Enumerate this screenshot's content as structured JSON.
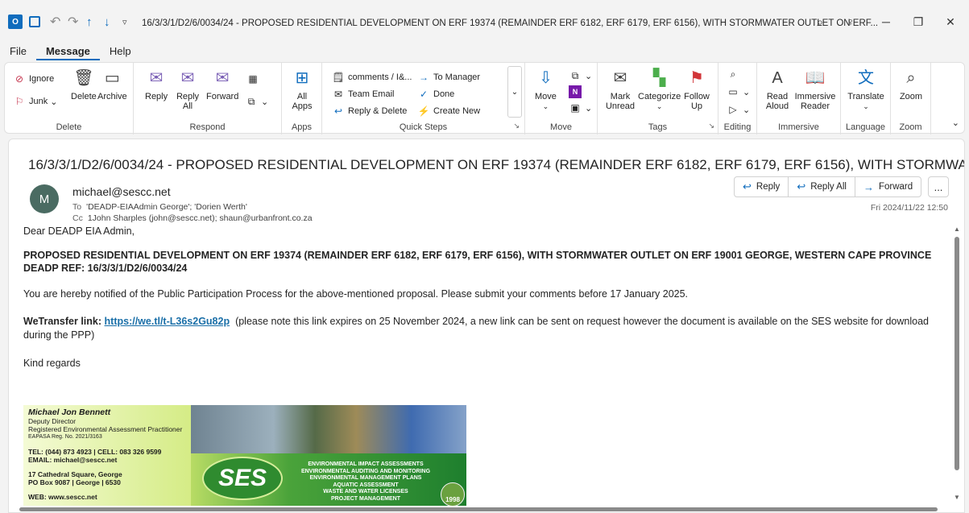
{
  "titlebar": {
    "app_letter": "O",
    "title": "16/3/3/1/D2/6/0034/24 - PROPOSED RESIDENTIAL DEVELOPMENT ON ERF 19374 (REMAINDER ERF 6182, ERF 6179, ERF 6156), WITH STORMWATER OUTLET ON ERF..."
  },
  "menu": {
    "tabs": [
      "File",
      "Message",
      "Help"
    ]
  },
  "ribbon": {
    "delete_group": {
      "label": "Delete",
      "ignore": "Ignore",
      "junk": "Junk",
      "delete": "Delete",
      "archive": "Archive"
    },
    "respond_group": {
      "label": "Respond",
      "reply": "Reply",
      "reply_all": "Reply All",
      "forward": "Forward"
    },
    "apps_group": {
      "label": "Apps",
      "all_apps": "All Apps"
    },
    "quick_steps": {
      "label": "Quick Steps",
      "items": [
        "comments / I&...",
        "To Manager",
        "Team Email",
        "Done",
        "Reply & Delete",
        "Create New"
      ]
    },
    "move_group": {
      "label": "Move",
      "move": "Move"
    },
    "tags_group": {
      "label": "Tags",
      "mark_unread": "Mark Unread",
      "categorize": "Categorize",
      "follow_up": "Follow Up"
    },
    "editing_group": {
      "label": "Editing"
    },
    "immersive_group": {
      "label": "Immersive",
      "read_aloud": "Read Aloud",
      "immersive_reader": "Immersive Reader"
    },
    "language_group": {
      "label": "Language",
      "translate": "Translate"
    },
    "zoom_group": {
      "label": "Zoom",
      "zoom": "Zoom"
    }
  },
  "email": {
    "subject": "16/3/3/1/D2/6/0034/24 - PROPOSED RESIDENTIAL DEVELOPMENT ON ERF 19374 (REMAINDER ERF 6182, ERF 6179, ERF 6156), WITH STORMWATER OUTL...",
    "avatar_letter": "M",
    "from": "michael@sescc.net",
    "to_label": "To",
    "to": "'DEADP-EIAAdmin George'; 'Dorien Werth'",
    "cc_label": "Cc",
    "cc": "1John Sharples (john@sescc.net); shaun@urbanfront.co.za",
    "datetime": "Fri 2024/11/22 12:50",
    "actions": {
      "reply": "Reply",
      "reply_all": "Reply All",
      "forward": "Forward",
      "more": "..."
    },
    "body": {
      "greeting": "Dear DEADP EIA Admin,",
      "heading1": "PROPOSED RESIDENTIAL DEVELOPMENT ON ERF 19374 (REMAINDER ERF 6182, ERF 6179, ERF 6156), WITH STORMWATER OUTLET ON ERF 19001 GEORGE, WESTERN CAPE PROVINCE",
      "heading2": "DEADP REF: 16/3/3/1/D2/6/0034/24",
      "notice": "You are hereby notified of the Public Participation Process for the above-mentioned proposal. Please submit your comments before 17 January 2025.",
      "wetransfer_label": "WeTransfer link:",
      "wetransfer_url": "https://we.tl/t-L36s2Gu82p",
      "wetransfer_note": "(please note this link expires on 25 November 2024, a new link can be sent on request however the document is available on the SES website for download during the PPP)",
      "closing": "Kind regards"
    },
    "signature": {
      "name": "Michael Jon Bennett",
      "title": "Deputy Director",
      "role": "Registered Environmental Assessment Practitioner",
      "reg": "EAPASA Reg. No. 2021/3163",
      "tel": "TEL: (044) 873 4923 | CELL: 083 326 9599",
      "email": "EMAIL: michael@sescc.net",
      "address1": "17 Cathedral Square, George",
      "address2": "PO Box 9087 | George | 6530",
      "web": "WEB: www.sescc.net",
      "logo": "SES",
      "services": [
        "ENVIRONMENTAL IMPACT ASSESSMENTS",
        "ENVIRONMENTAL AUDITING AND MONITORING",
        "ENVIRONMENTAL MANAGEMENT PLANS",
        "AQUATIC ASSESSMENT",
        "WASTE AND WATER LICENSES",
        "PROJECT MANAGEMENT"
      ],
      "year": "1998"
    }
  }
}
